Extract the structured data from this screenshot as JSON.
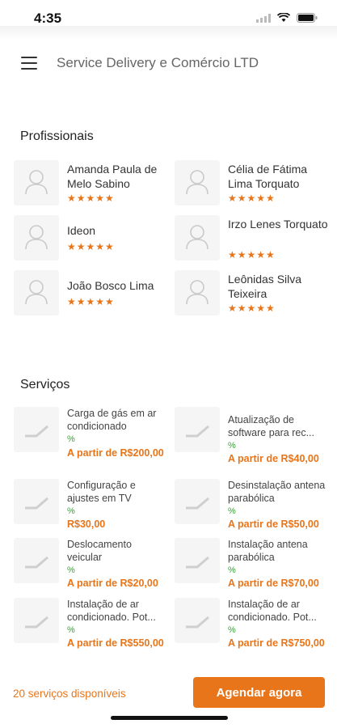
{
  "status_bar": {
    "time": "4:35"
  },
  "header": {
    "title": "Service Delivery e Comércio LTD"
  },
  "professionals": {
    "section_title": "Profissionais",
    "items": [
      {
        "name": "Amanda Paula de Melo Sabino",
        "stars": "★★★★★"
      },
      {
        "name": "Célia de Fátima Lima Torquato",
        "stars": "★★★★★"
      },
      {
        "name": "Ideon",
        "stars": "★★★★★"
      },
      {
        "name": "Irzo Lenes Torquato",
        "stars": "★★★★★"
      },
      {
        "name": "João Bosco Lima",
        "stars": "★★★★★"
      },
      {
        "name": "Leônidas Silva Teixeira",
        "stars": "★★★★★"
      }
    ]
  },
  "services": {
    "section_title": "Serviços",
    "items": [
      {
        "name": " Carga de gás em ar condicionado",
        "tag": "%",
        "price": "A partir de R$200,00"
      },
      {
        "name": "Atualização de software para rec...",
        "tag": "%",
        "price": "A partir de R$40,00"
      },
      {
        "name": "Configuração e ajustes em TV",
        "tag": "%",
        "price": "R$30,00"
      },
      {
        "name": "Desinstalação antena parabólica",
        "tag": "%",
        "price": "A partir de R$50,00"
      },
      {
        "name": "Deslocamento veicular",
        "tag": "%",
        "price": "A partir de R$20,00"
      },
      {
        "name": "Instalação antena parabólica",
        "tag": "%",
        "price": "A partir de R$70,00"
      },
      {
        "name": "Instalação de ar condicionado. Pot...",
        "tag": "%",
        "price": "A partir de R$550,00"
      },
      {
        "name": "Instalação de ar condicionado. Pot...",
        "tag": "%",
        "price": "A partir de R$750,00"
      }
    ]
  },
  "footer": {
    "available_label": "20 serviços disponíveis",
    "cta_label": "Agendar agora"
  },
  "colors": {
    "accent": "#e8751a",
    "tag_green": "#3aa33a"
  }
}
